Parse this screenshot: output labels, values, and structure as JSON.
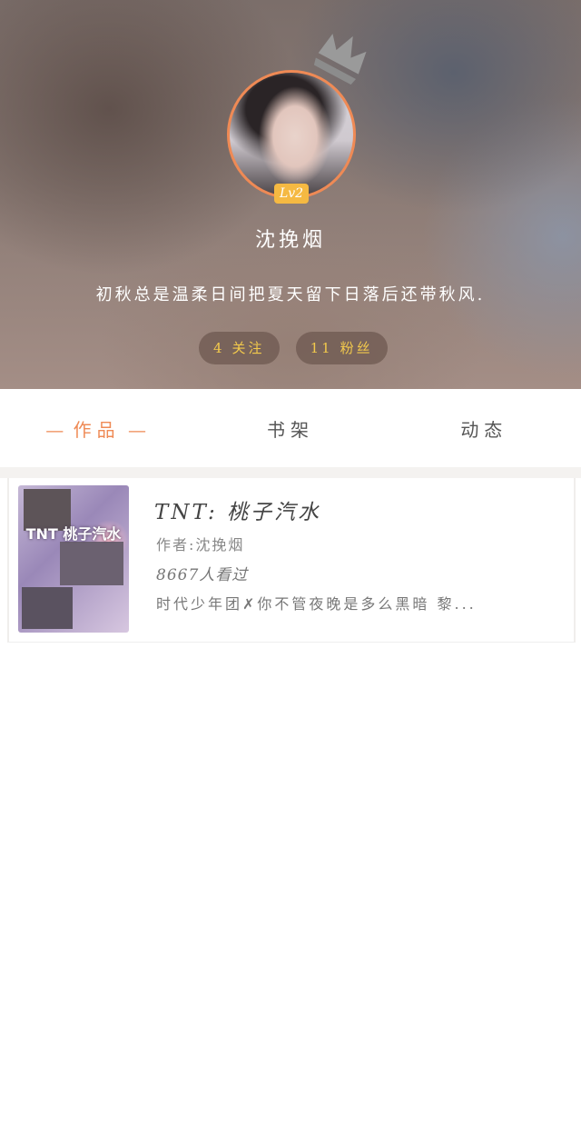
{
  "profile": {
    "level": "Lv2",
    "username": "沈挽烟",
    "bio": "初秋总是温柔日间把夏天留下日落后还带秋风.",
    "following_count": "4",
    "following_label": "关注",
    "followers_count": "11",
    "followers_label": "粉丝"
  },
  "tabs": [
    {
      "label": "作品",
      "active": true
    },
    {
      "label": "书架",
      "active": false
    },
    {
      "label": "动态",
      "active": false
    }
  ],
  "works": [
    {
      "cover_text": "TNT 桃子汽水",
      "title": "TNT:  桃子汽水",
      "author": "作者:沈挽烟",
      "views": "8667人看过",
      "description": "时代少年团✗你不管夜晚是多么黑暗 黎..."
    }
  ],
  "colors": {
    "accent": "#ef8a55",
    "badge": "#f5b942",
    "stat_text": "#f2c94c"
  },
  "icons": {
    "crown": "crown-icon"
  }
}
